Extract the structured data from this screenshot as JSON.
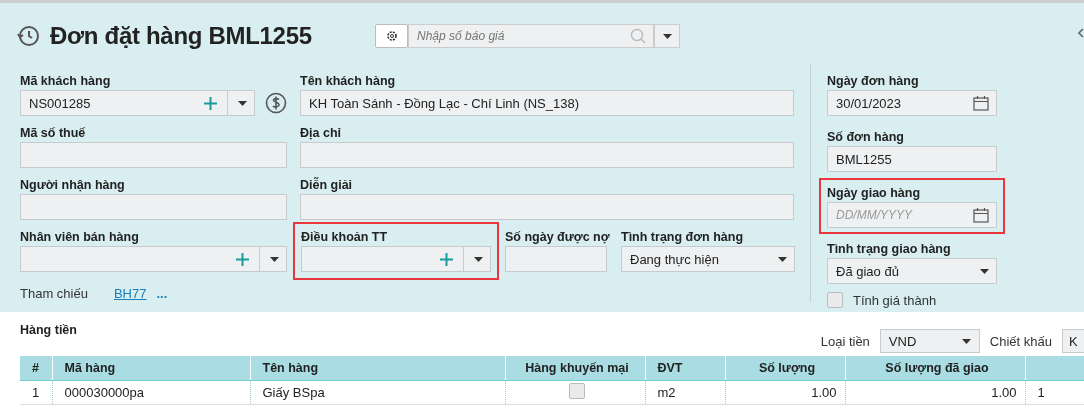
{
  "header": {
    "title": "Đơn đặt hàng BML1255",
    "quote_search": {
      "placeholder": "Nhập số báo giá"
    }
  },
  "left_rows": [
    [
      {
        "label": "Mã khách hàng",
        "kind": "combo",
        "value": "NS001285",
        "currency_button": true,
        "highlighted": false
      },
      {
        "label": "Tên khách hàng",
        "kind": "text",
        "value": "KH Toàn Sánh - Đồng Lạc - Chí Linh (NS_138)",
        "highlighted": false
      }
    ],
    [
      {
        "label": "Mã số thuế",
        "kind": "text",
        "highlighted": false
      },
      {
        "label": "Địa chỉ",
        "kind": "text",
        "highlighted": false
      }
    ],
    [
      {
        "label": "Người nhận hàng",
        "kind": "text",
        "highlighted": false
      },
      {
        "label": "Diễn giải",
        "kind": "text",
        "highlighted": false
      }
    ],
    [
      {
        "label": "Nhân viên bán hàng",
        "kind": "combo",
        "highlighted": false
      },
      {
        "label": "Điều khoản TT",
        "kind": "combo",
        "highlighted": true
      },
      {
        "label": "Số ngày được nợ",
        "kind": "text",
        "highlighted": false
      },
      {
        "label": "Tình trạng đơn hàng",
        "kind": "select",
        "value": "Đang thực hiện",
        "highlighted": false
      }
    ]
  ],
  "reference": {
    "label": "Tham chiếu",
    "link": "BH77",
    "more": "..."
  },
  "right_fields": [
    {
      "label": "Ngày đơn hàng",
      "kind": "date",
      "value": "30/01/2023",
      "highlighted": false
    },
    {
      "label": "Số đơn hàng",
      "kind": "text",
      "value": "BML1255",
      "highlighted": false
    },
    {
      "label": "Ngày giao hàng",
      "kind": "date",
      "placeholder": "DD/MM/YYYY",
      "highlighted": true
    },
    {
      "label": "Tình trạng giao hàng",
      "kind": "select",
      "value": "Đã giao đủ",
      "highlighted": false
    }
  ],
  "costing_checkbox": {
    "label": "Tính giá thành",
    "checked": false
  },
  "lines": {
    "title": "Hàng tiền",
    "currency": {
      "label": "Loại tiền",
      "value": "VND"
    },
    "discount": {
      "label": "Chiết khấu",
      "value": "K"
    },
    "columns": [
      "#",
      "Mã hàng",
      "Tên hàng",
      "Hàng khuyến mại",
      "ĐVT",
      "Số lượng",
      "Số lượng đã giao"
    ],
    "rows": [
      {
        "cells": [
          {
            "kind": "text",
            "text": "1"
          },
          {
            "kind": "text",
            "text": "000030000pa"
          },
          {
            "kind": "text",
            "text": "Giấy BSpa"
          },
          {
            "kind": "checkbox",
            "checked": false
          },
          {
            "kind": "text",
            "text": "m2"
          },
          {
            "kind": "number",
            "text": "1.00"
          },
          {
            "kind": "number",
            "text": "1.00"
          },
          {
            "kind": "text",
            "text": "1"
          }
        ]
      }
    ]
  }
}
